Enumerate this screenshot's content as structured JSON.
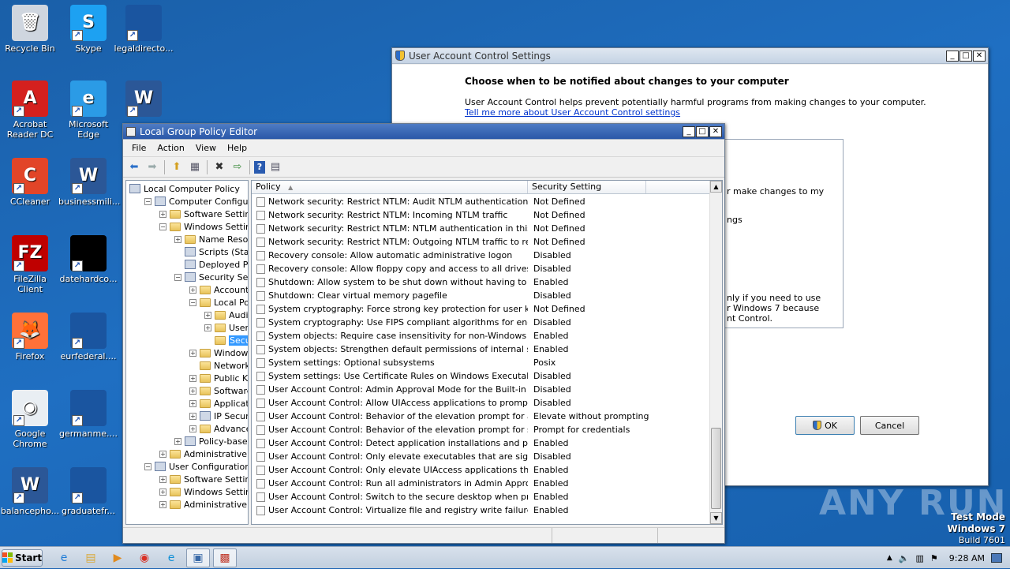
{
  "desktop": {
    "icons": [
      {
        "label": "Recycle Bin",
        "glyph": "🗑",
        "color": "#cfd6df"
      },
      {
        "label": "Skype",
        "glyph": "S",
        "color": "#1da1f2"
      },
      {
        "label": "legaldirecto...",
        "glyph": "",
        "color": "#1a55a0"
      },
      {
        "label": "Acrobat Reader DC",
        "glyph": "A",
        "color": "#d4201e"
      },
      {
        "label": "Microsoft Edge",
        "glyph": "e",
        "color": "#2b9be6"
      },
      {
        "label": "",
        "glyph": "W",
        "color": "#2b5797"
      },
      {
        "label": "CCleaner",
        "glyph": "C",
        "color": "#e24528"
      },
      {
        "label": "businessmili...",
        "glyph": "W",
        "color": "#2b5797"
      },
      {
        "label": "FileZilla Client",
        "glyph": "FZ",
        "color": "#bf0000"
      },
      {
        "label": "datehardco...",
        "glyph": "",
        "color": "#000000"
      },
      {
        "label": "Firefox",
        "glyph": "🦊",
        "color": "#ff7139"
      },
      {
        "label": "eurfederal....",
        "glyph": "",
        "color": "#1a55a0"
      },
      {
        "label": "Google Chrome",
        "glyph": "◉",
        "color": "#e9eef3"
      },
      {
        "label": "germanme....",
        "glyph": "",
        "color": "#1a55a0"
      },
      {
        "label": "balancepho...",
        "glyph": "W",
        "color": "#2b5797"
      },
      {
        "label": "graduatefr...",
        "glyph": "",
        "color": "#1a55a0"
      }
    ],
    "watermark": "ANY RUN",
    "testmode": {
      "line1": "Test Mode",
      "line2": "Windows 7",
      "line3": "Build 7601"
    }
  },
  "uac": {
    "title": "User Account Control Settings",
    "heading": "Choose when to be notified about changes to your computer",
    "description": "User Account Control helps prevent potentially harmful programs from making changes to your computer.",
    "link": "Tell me more about User Account Control settings",
    "partial1": "r make changes to my",
    "partial2": "ngs",
    "partial3": "nly if you need to use",
    "partial4": "r Windows 7 because",
    "partial5": "nt Control.",
    "ok": "OK",
    "cancel": "Cancel"
  },
  "gpedit": {
    "title": "Local Group Policy Editor",
    "menu": [
      "File",
      "Action",
      "View",
      "Help"
    ],
    "tree": [
      {
        "label": "Local Computer Policy",
        "depth": 0,
        "exp": "",
        "icon": "cfg"
      },
      {
        "label": "Computer Configuratio",
        "depth": 1,
        "exp": "−",
        "icon": "cfg"
      },
      {
        "label": "Software Settings",
        "depth": 2,
        "exp": "+",
        "icon": "folder"
      },
      {
        "label": "Windows Settings",
        "depth": 2,
        "exp": "−",
        "icon": "folder"
      },
      {
        "label": "Name Resolutic",
        "depth": 3,
        "exp": "+",
        "icon": "folder"
      },
      {
        "label": "Scripts (Startup",
        "depth": 3,
        "exp": "",
        "icon": "cfg"
      },
      {
        "label": "Deployed Printe",
        "depth": 3,
        "exp": "",
        "icon": "cfg"
      },
      {
        "label": "Security Settin",
        "depth": 3,
        "exp": "−",
        "icon": "cfg"
      },
      {
        "label": "Account Pc",
        "depth": 4,
        "exp": "+",
        "icon": "folder"
      },
      {
        "label": "Local Policie",
        "depth": 4,
        "exp": "−",
        "icon": "folder"
      },
      {
        "label": "Audit P",
        "depth": 5,
        "exp": "+",
        "icon": "folder"
      },
      {
        "label": "User Ri",
        "depth": 5,
        "exp": "+",
        "icon": "folder"
      },
      {
        "label": "Securit",
        "depth": 5,
        "exp": "",
        "icon": "folder",
        "selected": true
      },
      {
        "label": "Windows F",
        "depth": 4,
        "exp": "+",
        "icon": "folder"
      },
      {
        "label": "Network Lis",
        "depth": 4,
        "exp": "",
        "icon": "folder"
      },
      {
        "label": "Public Key I",
        "depth": 4,
        "exp": "+",
        "icon": "folder"
      },
      {
        "label": "Software R",
        "depth": 4,
        "exp": "+",
        "icon": "folder"
      },
      {
        "label": "Application",
        "depth": 4,
        "exp": "+",
        "icon": "folder"
      },
      {
        "label": "IP Security",
        "depth": 4,
        "exp": "+",
        "icon": "cfg"
      },
      {
        "label": "Advanced",
        "depth": 4,
        "exp": "+",
        "icon": "folder"
      },
      {
        "label": "Policy-based Q",
        "depth": 3,
        "exp": "+",
        "icon": "cfg"
      },
      {
        "label": "Administrative Tem",
        "depth": 2,
        "exp": "+",
        "icon": "folder"
      },
      {
        "label": "User Configuration",
        "depth": 1,
        "exp": "−",
        "icon": "cfg"
      },
      {
        "label": "Software Settings",
        "depth": 2,
        "exp": "+",
        "icon": "folder"
      },
      {
        "label": "Windows Settings",
        "depth": 2,
        "exp": "+",
        "icon": "folder"
      },
      {
        "label": "Administrative Tem",
        "depth": 2,
        "exp": "+",
        "icon": "folder"
      }
    ],
    "columns": {
      "policy": "Policy",
      "setting": "Security Setting"
    },
    "rows": [
      {
        "policy": "Network security: Restrict NTLM: Audit NTLM authentication in thi...",
        "setting": "Not Defined"
      },
      {
        "policy": "Network security: Restrict NTLM: Incoming NTLM traffic",
        "setting": "Not Defined"
      },
      {
        "policy": "Network security: Restrict NTLM: NTLM authentication in this dom...",
        "setting": "Not Defined"
      },
      {
        "policy": "Network security: Restrict NTLM: Outgoing NTLM traffic to remot...",
        "setting": "Not Defined"
      },
      {
        "policy": "Recovery console: Allow automatic administrative logon",
        "setting": "Disabled"
      },
      {
        "policy": "Recovery console: Allow floppy copy and access to all drives and ...",
        "setting": "Disabled"
      },
      {
        "policy": "Shutdown: Allow system to be shut down without having to log on",
        "setting": "Enabled"
      },
      {
        "policy": "Shutdown: Clear virtual memory pagefile",
        "setting": "Disabled"
      },
      {
        "policy": "System cryptography: Force strong key protection for user keys ...",
        "setting": "Not Defined"
      },
      {
        "policy": "System cryptography: Use FIPS compliant algorithms for encrypti...",
        "setting": "Disabled"
      },
      {
        "policy": "System objects: Require case insensitivity for non-Windows subs...",
        "setting": "Enabled"
      },
      {
        "policy": "System objects: Strengthen default permissions of internal syste...",
        "setting": "Enabled"
      },
      {
        "policy": "System settings: Optional subsystems",
        "setting": "Posix"
      },
      {
        "policy": "System settings: Use Certificate Rules on Windows Executables f...",
        "setting": "Disabled"
      },
      {
        "policy": "User Account Control: Admin Approval Mode for the Built-in Admi...",
        "setting": "Disabled"
      },
      {
        "policy": "User Account Control: Allow UIAccess applications to prompt for ...",
        "setting": "Disabled"
      },
      {
        "policy": "User Account Control: Behavior of the elevation prompt for admi...",
        "setting": "Elevate without prompting"
      },
      {
        "policy": "User Account Control: Behavior of the elevation prompt for stand...",
        "setting": "Prompt for credentials"
      },
      {
        "policy": "User Account Control: Detect application installations and prompt...",
        "setting": "Enabled"
      },
      {
        "policy": "User Account Control: Only elevate executables that are signed ...",
        "setting": "Disabled"
      },
      {
        "policy": "User Account Control: Only elevate UIAccess applications that ar...",
        "setting": "Enabled"
      },
      {
        "policy": "User Account Control: Run all administrators in Admin Approval M...",
        "setting": "Enabled"
      },
      {
        "policy": "User Account Control: Switch to the secure desktop when prompt...",
        "setting": "Enabled"
      },
      {
        "policy": "User Account Control: Virtualize file and registry write failures to ...",
        "setting": "Enabled"
      }
    ]
  },
  "taskbar": {
    "start": "Start",
    "apps": [
      {
        "name": "ie-icon",
        "glyph": "e",
        "color": "#1e7bd6"
      },
      {
        "name": "explorer-icon",
        "glyph": "▤",
        "color": "#d9a93a"
      },
      {
        "name": "media-player-icon",
        "glyph": "▶",
        "color": "#e08a1e"
      },
      {
        "name": "chrome-icon",
        "glyph": "◉",
        "color": "#d93025"
      },
      {
        "name": "edge-icon",
        "glyph": "e",
        "color": "#0f8fd6"
      },
      {
        "name": "gpedit-icon",
        "glyph": "▣",
        "color": "#3a6aa8"
      },
      {
        "name": "uac-settings-icon",
        "glyph": "▩",
        "color": "#c0392b"
      }
    ],
    "time": "9:28 AM"
  }
}
